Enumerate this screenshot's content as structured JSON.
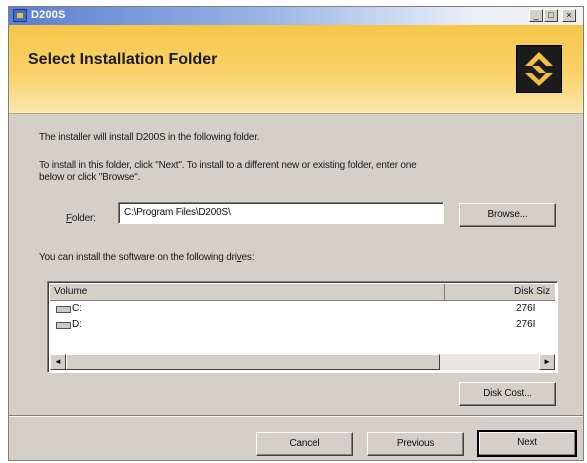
{
  "window": {
    "title": "D200S",
    "minimize_glyph": "_",
    "maximize_glyph": "□",
    "close_glyph": "×",
    "icon": "installer-app-icon"
  },
  "header": {
    "title": "Select Installation Folder",
    "logo_icon": "brand-logo-icon",
    "colors": {
      "band": "#f6c64a",
      "logo_bg": "#1c1c1c",
      "logo_mark": "#f0c040"
    }
  },
  "body": {
    "intro": "The installer will install D200S in the following folder.",
    "instructions_line1": "To install in this folder, click \"Next\". To install to a different new or existing folder, enter one",
    "instructions_line2": "below or click \"Browse\".",
    "folder_label_accel": "F",
    "folder_label_rest": "older:",
    "folder_value": "C:\\Program Files\\D200S\\",
    "browse_label": "Browse...",
    "drives_text_before": "You can install the software on the following dri",
    "drives_text_accel": "v",
    "drives_text_after": "es:"
  },
  "volume_list": {
    "columns": [
      "Volume",
      "Disk Siz"
    ],
    "rows": [
      {
        "volume": "C:",
        "disk_size": "276I",
        "icon": "hard-drive-icon"
      },
      {
        "volume": "D:",
        "disk_size": "276I",
        "icon": "hard-drive-icon"
      }
    ],
    "scroll_left": "◄",
    "scroll_right": "►"
  },
  "buttons": {
    "disk_cost": "Disk Cost...",
    "cancel": "Cancel",
    "previous": "Previous",
    "next": "Next"
  }
}
